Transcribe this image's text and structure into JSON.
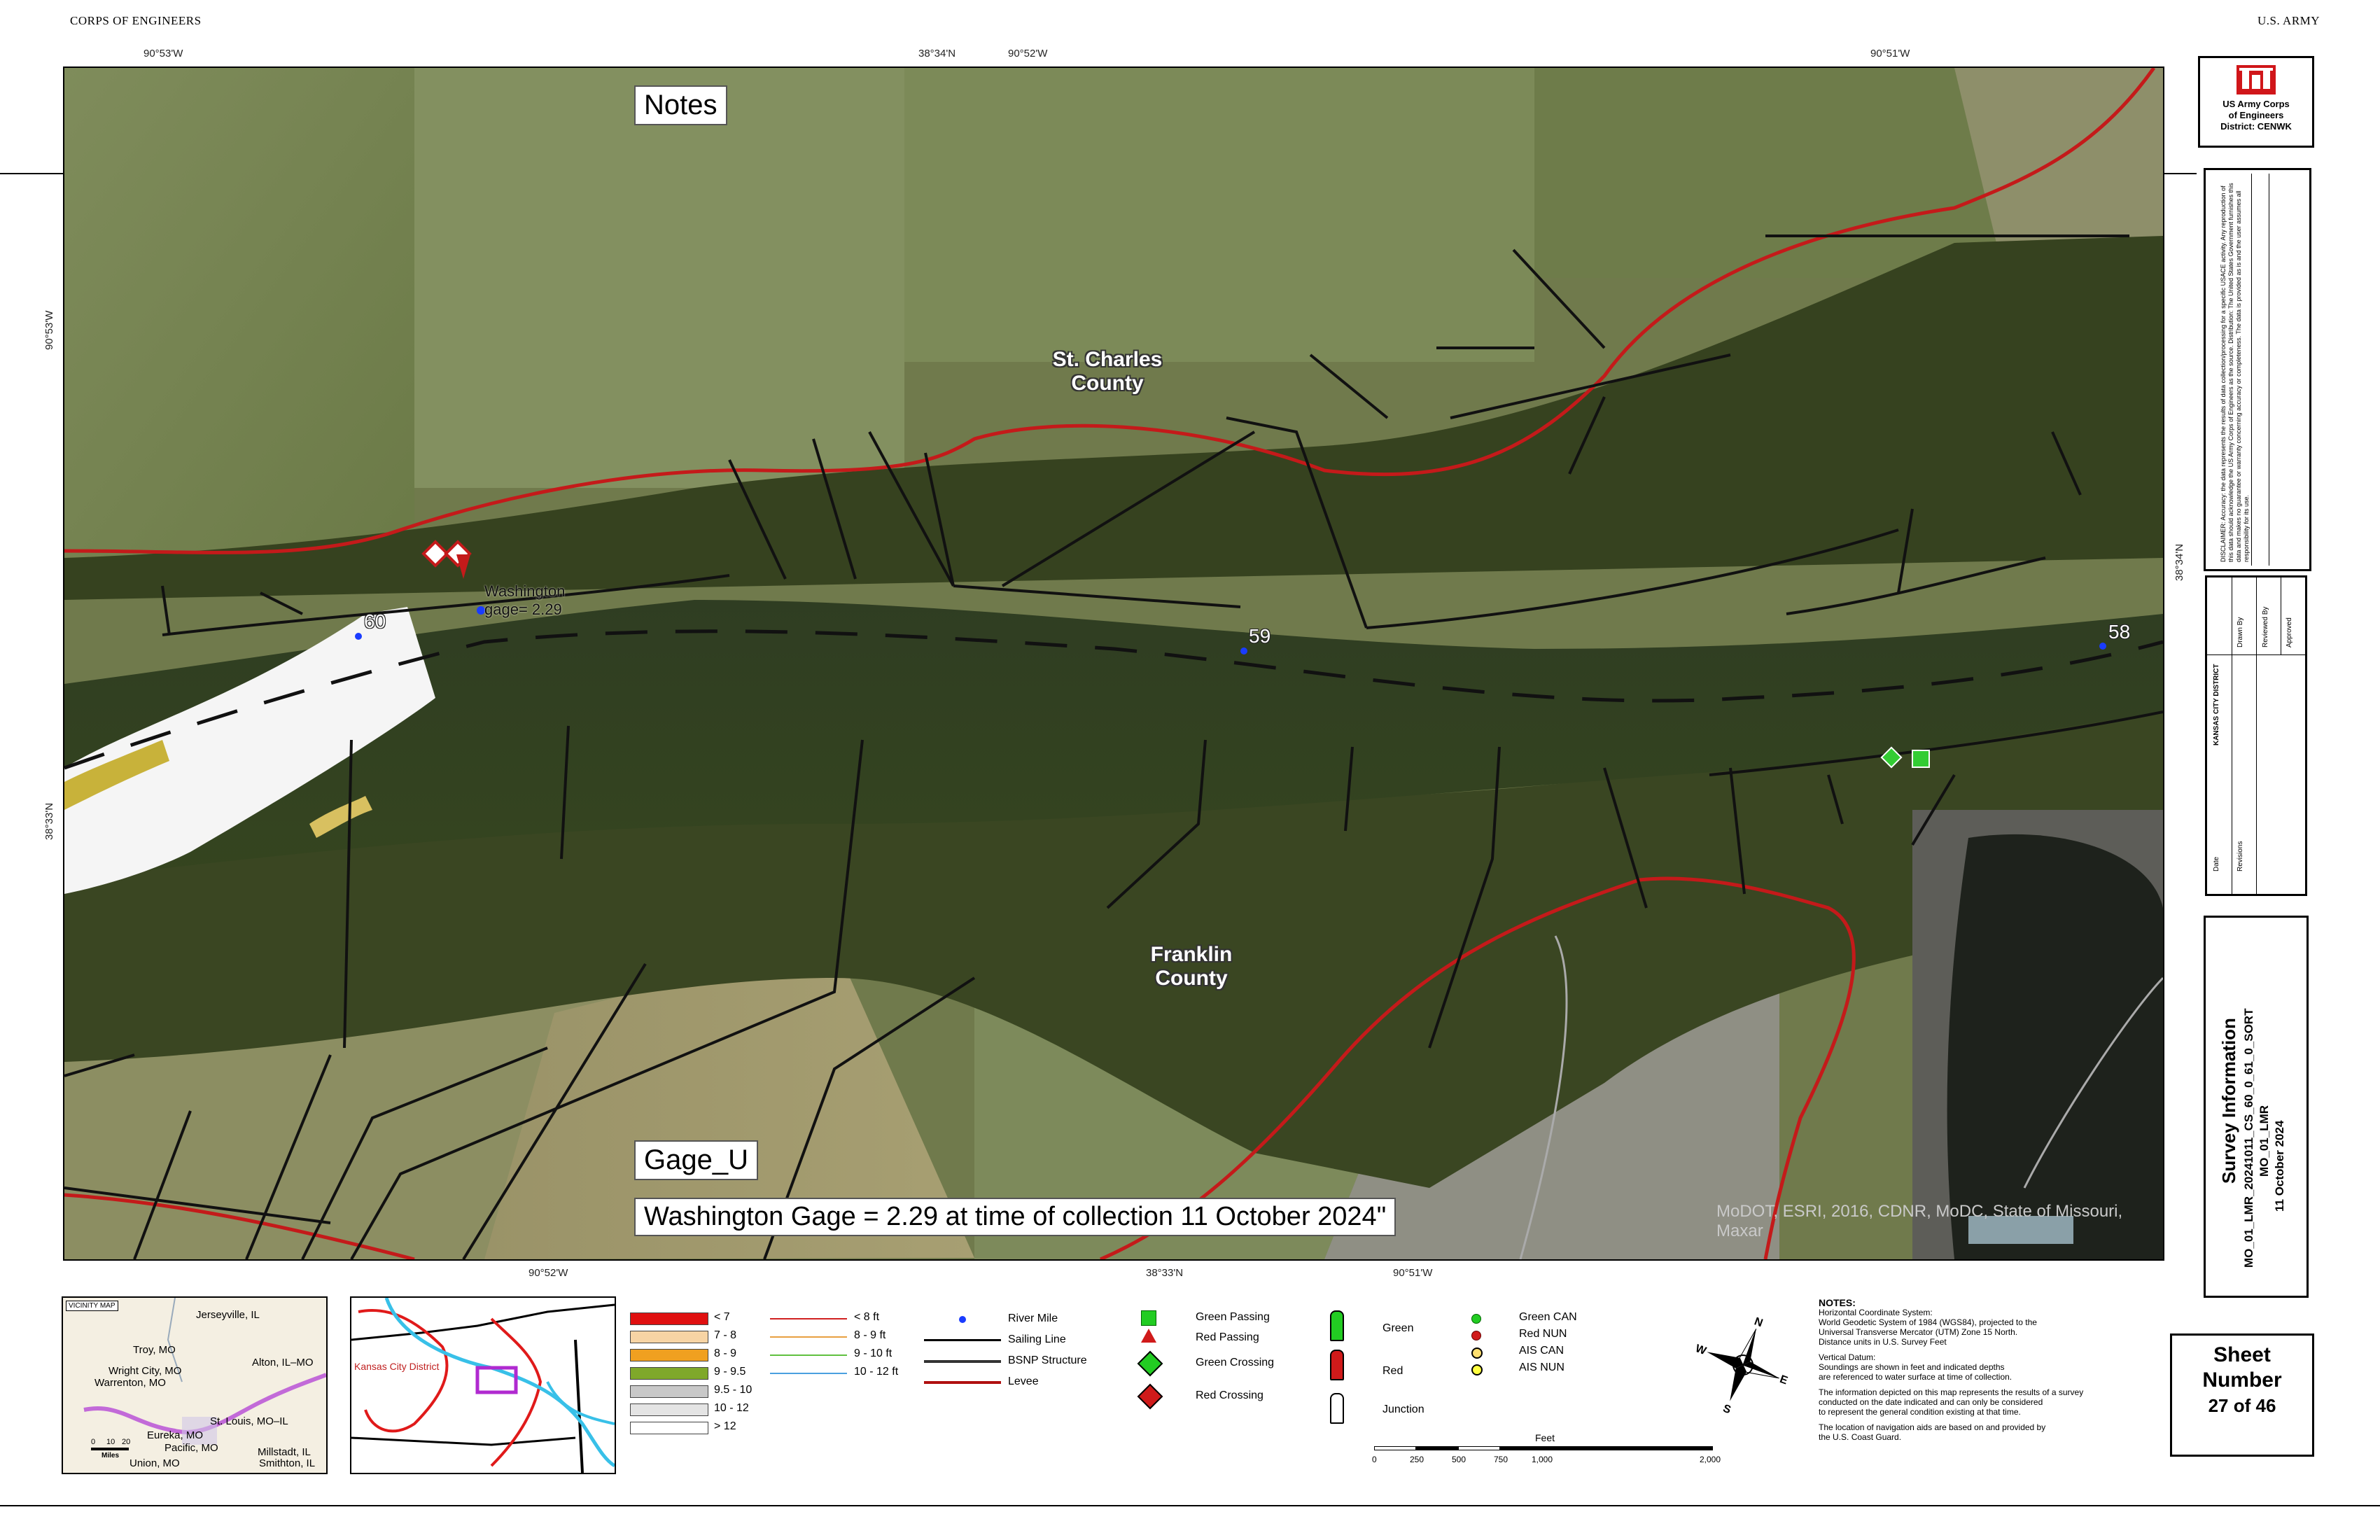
{
  "header": {
    "left": "CORPS OF ENGINEERS",
    "right": "U.S. ARMY"
  },
  "coords": {
    "top": [
      "90°53'W",
      "38°34'N",
      "90°52'W",
      "90°51'W"
    ],
    "bottom": [
      "90°52'W",
      "38°33'N",
      "90°51'W"
    ],
    "left": [
      "90°53'W",
      "38°33'N"
    ],
    "right": [
      "38°34'N"
    ]
  },
  "map": {
    "counties": {
      "north": "St. Charles\nCounty",
      "south": "Franklin\nCounty"
    },
    "river_miles": [
      "60",
      "59",
      "58"
    ],
    "gage_label": "Washington\ngage= 2.29",
    "notes_box": "Notes",
    "gage_box": "Gage_U",
    "gage_text": "Washington Gage = 2.29 at time of collection 11 October 2024\"",
    "credits": "MoDOT, ESRI, 2016, CDNR, MoDC, State of Missouri, Maxar"
  },
  "logo": {
    "line1": "US Army Corps",
    "line2": "of Engineers",
    "line3": "District: CENWK"
  },
  "disclaimer": "DISCLAIMER: Accuracy: the data represents the results of data collection/processing for a specific USACE activity. Any reproduction of this data should acknowledge the US Army Corps of Engineers as the source. Distribution: The United States Government furnishes this data and makes no guarantee or warranty concerning accuracy or completeness. The data is provided as is and the user assumes all responsibility for its use.",
  "approvals": [
    "Drawn By",
    "Reviewed By",
    "Approved",
    "Date",
    "Revisions",
    "KANSAS CITY DISTRICT"
  ],
  "survey": {
    "title": "Survey Information",
    "line1": "MO_01_LMR_20241011_CS_60_0_61_0_SORT",
    "line2": "MO_01_LMR",
    "line3": "11 October 2024"
  },
  "sheet": {
    "label1": "Sheet",
    "label2": "Number",
    "value": "27 of 46"
  },
  "vicinity": {
    "title": "VICINITY MAP",
    "places": [
      "Jerseyville, IL",
      "Troy, MO",
      "Alton, IL–MO",
      "Wright City, MO",
      "Warrenton, MO",
      "St. Louis, MO–IL",
      "Eureka, MO",
      "Pacific, MO",
      "Union, MO",
      "Millstadt, IL",
      "Smithton, IL"
    ],
    "scale": [
      "0",
      "10",
      "20"
    ],
    "scale_unit": "Miles"
  },
  "district_map": {
    "label": "Kansas City District"
  },
  "depth_legend": {
    "items": [
      {
        "label": "< 7",
        "color": "#e01010"
      },
      {
        "label": "7 - 8",
        "color": "#f7d4a4"
      },
      {
        "label": "8 - 9",
        "color": "#f0a020"
      },
      {
        "label": "9 - 9.5",
        "color": "#7fa82a"
      },
      {
        "label": "9.5 - 10",
        "color": "#c8c8c8"
      },
      {
        "label": "10 - 12",
        "color": "#e4e4e4"
      },
      {
        "label": "> 12",
        "color": "#ffffff"
      }
    ],
    "contours": [
      {
        "label": "< 8 ft",
        "color": "#d02020"
      },
      {
        "label": "8 - 9 ft",
        "color": "#e8a040"
      },
      {
        "label": "9 - 10 ft",
        "color": "#60c040"
      },
      {
        "label": "10 - 12 ft",
        "color": "#4aa0e0"
      }
    ]
  },
  "line_legend": [
    {
      "label": "River Mile",
      "kind": "dot"
    },
    {
      "label": "Sailing Line",
      "kind": "line",
      "color": "#000"
    },
    {
      "label": "BSNP Structure",
      "kind": "line",
      "color": "#333"
    },
    {
      "label": "Levee",
      "kind": "line",
      "color": "#b01010"
    }
  ],
  "nav_legend": [
    "Green Passing",
    "Red Passing",
    "Green Crossing",
    "Red Crossing"
  ],
  "buoy_legend": {
    "green": "Green",
    "red": "Red",
    "junction": "Junction"
  },
  "aid_legend": [
    "Green CAN",
    "Red NUN",
    "AIS CAN",
    "AIS NUN"
  ],
  "scalebar": {
    "unit": "Feet",
    "ticks": [
      "0",
      "250",
      "500",
      "750",
      "1,000",
      "2,000"
    ]
  },
  "notes": {
    "title": "NOTES:",
    "lines": [
      "Horizontal Coordinate System:",
      "World Geodetic System of 1984 (WGS84), projected to the",
      "Universal Transverse Mercator (UTM) Zone 15 North.",
      "Distance units in U.S. Survey Feet",
      "",
      "Vertical Datum:",
      "Soundings are shown in feet and indicated depths",
      "are referenced to water surface at time of collection.",
      "",
      "The information depicted on this map represents the results of a survey",
      "conducted on the date indicated and can only be considered",
      "to represent the general condition existing at that time.",
      "",
      "The location of navigation aids are based on and provided by",
      "the U.S. Coast Guard."
    ]
  }
}
